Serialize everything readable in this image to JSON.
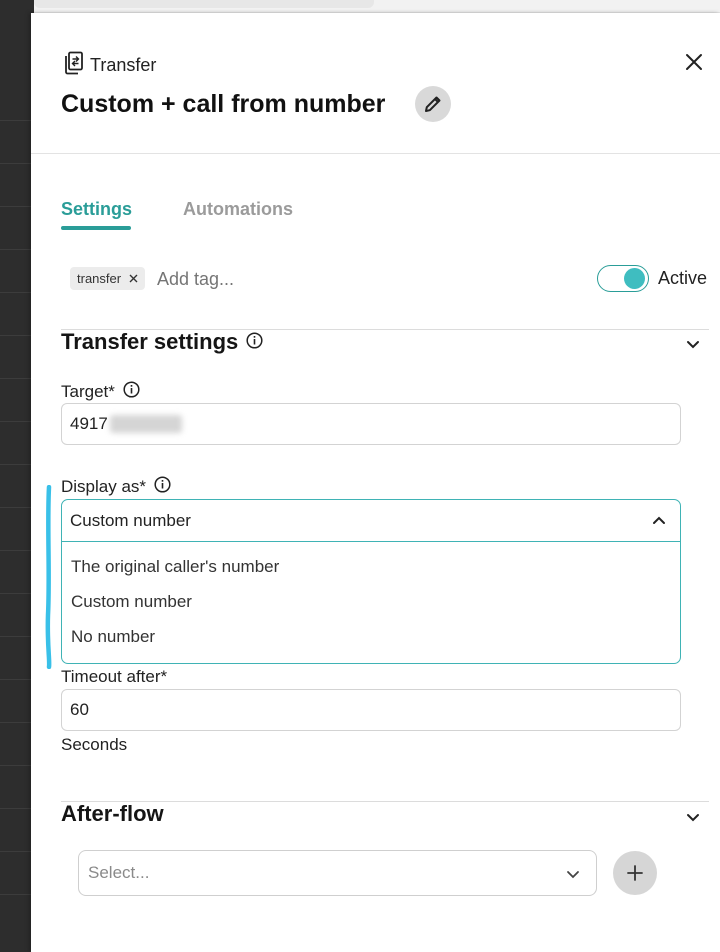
{
  "header": {
    "kind_label": "Transfer",
    "title": "Custom + call from number"
  },
  "tabs": [
    {
      "label": "Settings",
      "active": true
    },
    {
      "label": "Automations",
      "active": false
    }
  ],
  "tags": {
    "items": [
      "transfer"
    ],
    "input_placeholder": "Add tag..."
  },
  "status_toggle": {
    "label": "Active",
    "on": true
  },
  "transfer_settings": {
    "title": "Transfer settings",
    "target": {
      "label": "Target*",
      "value": "4917"
    },
    "display_as": {
      "label": "Display as*",
      "selected": "Custom number",
      "options": [
        "The original caller's number",
        "Custom number",
        "No number"
      ]
    },
    "timeout": {
      "label": "Timeout after*",
      "value": "60",
      "unit": "Seconds"
    }
  },
  "after_flow": {
    "title": "After-flow",
    "select_placeholder": "Select..."
  },
  "colors": {
    "accent": "#2a9d98",
    "toggle_knob": "#3fbdc0",
    "highlight_mark": "#39c0e8"
  },
  "icons": [
    "transfer-icon",
    "close-icon",
    "pencil-icon",
    "tag-remove-icon",
    "info-icon",
    "chevron-down-icon",
    "chevron-up-icon",
    "plus-icon"
  ]
}
